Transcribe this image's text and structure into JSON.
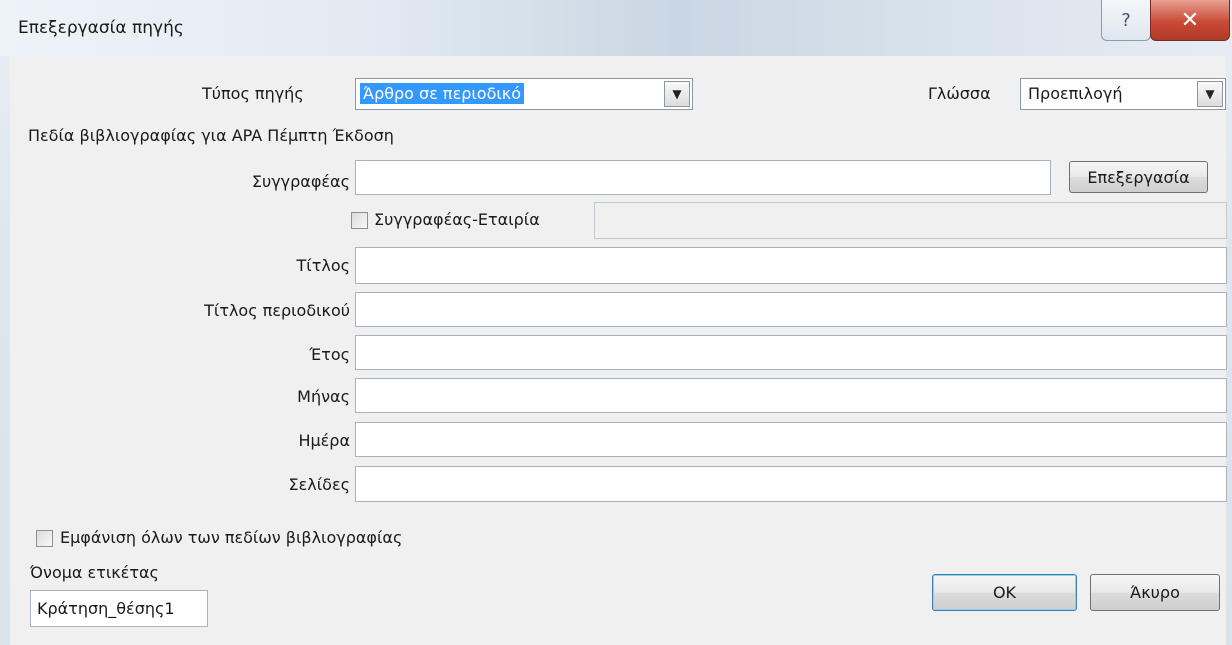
{
  "window": {
    "title": "Επεξεργασία πηγής",
    "help_glyph": "?",
    "close_glyph": "✕"
  },
  "source_type": {
    "label": "Τύπος πηγής",
    "value": "Άρθρο σε περιοδικό"
  },
  "language": {
    "label": "Γλώσσα",
    "value": "Προεπιλογή"
  },
  "section_heading": "Πεδία βιβλιογραφίας για APA Πέμπτη Έκδοση",
  "author": {
    "label": "Συγγραφέας",
    "value": "",
    "edit_button": "Επεξεργασία",
    "corporate_label": "Συγγραφέας-Εταιρία",
    "corporate_checked": false,
    "corporate_value": ""
  },
  "fields": [
    {
      "label": "Τίτλος",
      "value": ""
    },
    {
      "label": "Τίτλος περιοδικού",
      "value": ""
    },
    {
      "label": "Έτος",
      "value": ""
    },
    {
      "label": "Μήνας",
      "value": ""
    },
    {
      "label": "Ημέρα",
      "value": ""
    },
    {
      "label": "Σελίδες",
      "value": ""
    }
  ],
  "show_all": {
    "label": "Εμφάνιση όλων των πεδίων βιβλιογραφίας",
    "checked": false
  },
  "tag_name": {
    "label": "Όνομα ετικέτας",
    "value": "Κράτηση_θέσης1"
  },
  "buttons": {
    "ok": "OK",
    "cancel": "Άκυρο"
  },
  "colors": {
    "selection": "#3399ff",
    "close_button": "#c94a36",
    "dialog_bg": "#f0f0f0"
  }
}
